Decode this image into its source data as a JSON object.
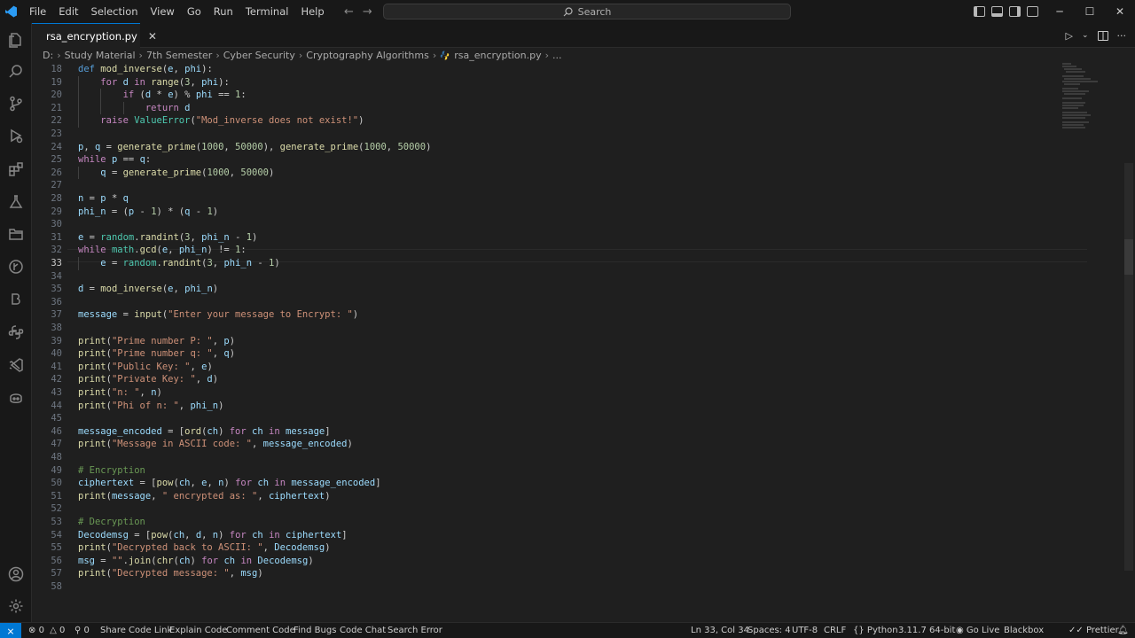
{
  "menu": [
    "File",
    "Edit",
    "Selection",
    "View",
    "Go",
    "Run",
    "Terminal",
    "Help"
  ],
  "search": {
    "label": "Search"
  },
  "tab": {
    "filename": "rsa_encryption.py"
  },
  "breadcrumb": [
    "D:",
    "Study Material",
    "7th Semester",
    "Cyber Security",
    "Cryptography Algorithms",
    "rsa_encryption.py",
    "..."
  ],
  "editor": {
    "current_line": 33,
    "lines": [
      {
        "n": 18,
        "html": "<span class='kw2'>def</span> <span class='fn'>mod_inverse</span>(<span class='vr'>e</span>, <span class='vr'>phi</span>):"
      },
      {
        "n": 19,
        "html": "    <span class='kw'>for</span> <span class='vr'>d</span> <span class='kw'>in</span> <span class='fn'>range</span>(<span class='nm'>3</span>, <span class='vr'>phi</span>):"
      },
      {
        "n": 20,
        "html": "        <span class='kw'>if</span> (<span class='vr'>d</span> * <span class='vr'>e</span>) % <span class='vr'>phi</span> == <span class='nm'>1</span>:"
      },
      {
        "n": 21,
        "html": "            <span class='kw'>return</span> <span class='vr'>d</span>"
      },
      {
        "n": 22,
        "html": "    <span class='kw'>raise</span> <span class='cls'>ValueError</span>(<span class='st'>\"Mod_inverse does not exist!\"</span>)"
      },
      {
        "n": 23,
        "html": ""
      },
      {
        "n": 24,
        "html": "<span class='vr'>p</span>, <span class='vr'>q</span> = <span class='fn'>generate_prime</span>(<span class='nm'>1000</span>, <span class='nm'>50000</span>), <span class='fn'>generate_prime</span>(<span class='nm'>1000</span>, <span class='nm'>50000</span>)"
      },
      {
        "n": 25,
        "html": "<span class='kw'>while</span> <span class='vr'>p</span> == <span class='vr'>q</span>:"
      },
      {
        "n": 26,
        "html": "    <span class='vr'>q</span> = <span class='fn'>generate_prime</span>(<span class='nm'>1000</span>, <span class='nm'>50000</span>)"
      },
      {
        "n": 27,
        "html": ""
      },
      {
        "n": 28,
        "html": "<span class='vr'>n</span> = <span class='vr'>p</span> * <span class='vr'>q</span>"
      },
      {
        "n": 29,
        "html": "<span class='vr'>phi_n</span> = (<span class='vr'>p</span> - <span class='nm'>1</span>) * (<span class='vr'>q</span> - <span class='nm'>1</span>)"
      },
      {
        "n": 30,
        "html": ""
      },
      {
        "n": 31,
        "html": "<span class='vr'>e</span> = <span class='cls'>random</span>.<span class='fn'>randint</span>(<span class='nm'>3</span>, <span class='vr'>phi_n</span> - <span class='nm'>1</span>)"
      },
      {
        "n": 32,
        "html": "<span class='kw'>while</span> <span class='cls'>math</span>.<span class='fn'>gcd</span>(<span class='vr'>e</span>, <span class='vr'>phi_n</span>) != <span class='nm'>1</span>:"
      },
      {
        "n": 33,
        "html": "    <span class='vr'>e</span> = <span class='cls'>random</span>.<span class='fn'>randint</span>(<span class='nm'>3</span>, <span class='vr'>phi_n</span> - <span class='nm'>1</span>)"
      },
      {
        "n": 34,
        "html": ""
      },
      {
        "n": 35,
        "html": "<span class='vr'>d</span> = <span class='fn'>mod_inverse</span>(<span class='vr'>e</span>, <span class='vr'>phi_n</span>)"
      },
      {
        "n": 36,
        "html": ""
      },
      {
        "n": 37,
        "html": "<span class='vr'>message</span> = <span class='fn'>input</span>(<span class='st'>\"Enter your message to Encrypt: \"</span>)"
      },
      {
        "n": 38,
        "html": ""
      },
      {
        "n": 39,
        "html": "<span class='fn'>print</span>(<span class='st'>\"Prime number P: \"</span>, <span class='vr'>p</span>)"
      },
      {
        "n": 40,
        "html": "<span class='fn'>print</span>(<span class='st'>\"Prime number q: \"</span>, <span class='vr'>q</span>)"
      },
      {
        "n": 41,
        "html": "<span class='fn'>print</span>(<span class='st'>\"Public Key: \"</span>, <span class='vr'>e</span>)"
      },
      {
        "n": 42,
        "html": "<span class='fn'>print</span>(<span class='st'>\"Private Key: \"</span>, <span class='vr'>d</span>)"
      },
      {
        "n": 43,
        "html": "<span class='fn'>print</span>(<span class='st'>\"n: \"</span>, <span class='vr'>n</span>)"
      },
      {
        "n": 44,
        "html": "<span class='fn'>print</span>(<span class='st'>\"Phi of n: \"</span>, <span class='vr'>phi_n</span>)"
      },
      {
        "n": 45,
        "html": ""
      },
      {
        "n": 46,
        "html": "<span class='vr'>message_encoded</span> = [<span class='fn'>ord</span>(<span class='vr'>ch</span>) <span class='kw'>for</span> <span class='vr'>ch</span> <span class='kw'>in</span> <span class='vr'>message</span>]"
      },
      {
        "n": 47,
        "html": "<span class='fn'>print</span>(<span class='st'>\"Message in ASCII code: \"</span>, <span class='vr'>message_encoded</span>)"
      },
      {
        "n": 48,
        "html": ""
      },
      {
        "n": 49,
        "html": "<span class='cm'># Encryption</span>"
      },
      {
        "n": 50,
        "html": "<span class='vr'>ciphertext</span> = [<span class='fn'>pow</span>(<span class='vr'>ch</span>, <span class='vr'>e</span>, <span class='vr'>n</span>) <span class='kw'>for</span> <span class='vr'>ch</span> <span class='kw'>in</span> <span class='vr'>message_encoded</span>]"
      },
      {
        "n": 51,
        "html": "<span class='fn'>print</span>(<span class='vr'>message</span>, <span class='st'>\" encrypted as: \"</span>, <span class='vr'>ciphertext</span>)"
      },
      {
        "n": 52,
        "html": ""
      },
      {
        "n": 53,
        "html": "<span class='cm'># Decryption</span>"
      },
      {
        "n": 54,
        "html": "<span class='vr'>Decodemsg</span> = [<span class='fn'>pow</span>(<span class='vr'>ch</span>, <span class='vr'>d</span>, <span class='vr'>n</span>) <span class='kw'>for</span> <span class='vr'>ch</span> <span class='kw'>in</span> <span class='vr'>ciphertext</span>]"
      },
      {
        "n": 55,
        "html": "<span class='fn'>print</span>(<span class='st'>\"Decrypted back to ASCII: \"</span>, <span class='vr'>Decodemsg</span>)"
      },
      {
        "n": 56,
        "html": "<span class='vr'>msg</span> = <span class='st'>\"\"</span>.<span class='fn'>join</span>(<span class='fn'>chr</span>(<span class='vr'>ch</span>) <span class='kw'>for</span> <span class='vr'>ch</span> <span class='kw'>in</span> <span class='vr'>Decodemsg</span>)"
      },
      {
        "n": 57,
        "html": "<span class='fn'>print</span>(<span class='st'>\"Decrypted message: \"</span>, <span class='vr'>msg</span>)"
      },
      {
        "n": 58,
        "html": ""
      }
    ]
  },
  "status": {
    "errors": "0",
    "warnings": "0",
    "ports": "0",
    "share_code_link": "Share Code Link",
    "explain_code": "Explain Code",
    "comment_code": "Comment Code",
    "find_bugs": "Find Bugs",
    "code_chat": "Code Chat",
    "search_error": "Search Error",
    "cursor": "Ln 33, Col 34",
    "spaces": "Spaces: 4",
    "encoding": "UTF-8",
    "eol": "CRLF",
    "language": "Python",
    "interpreter": "3.11.7 64-bit",
    "go_live": "Go Live",
    "blackbox": "Blackbox",
    "prettier": "Prettier"
  },
  "colors": {
    "accent": "#0078d4",
    "background": "#1f1f1f",
    "bar": "#181818"
  }
}
